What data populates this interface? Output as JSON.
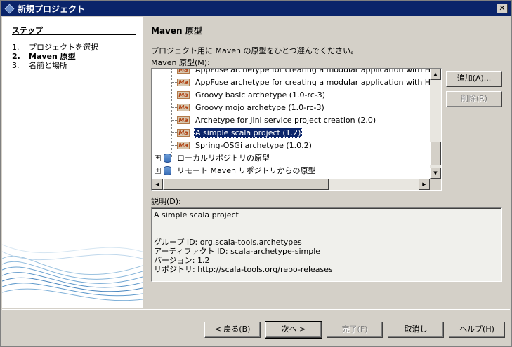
{
  "window": {
    "title": "新規プロジェクト",
    "close_glyph": "✕"
  },
  "steps": {
    "heading": "ステップ",
    "items": [
      {
        "num": "1.",
        "label": "プロジェクトを選択"
      },
      {
        "num": "2.",
        "label": "Maven 原型"
      },
      {
        "num": "3.",
        "label": "名前と場所"
      }
    ]
  },
  "main": {
    "title": "Maven 原型",
    "description": "プロジェクト用に Maven の原型をひとつ選んでください。",
    "list_label": "Maven 原型(M):",
    "archetypes": [
      "AppFuse archetype for creating a modular application with Hiber",
      "AppFuse archetype for creating a modular application with Hiber",
      "Groovy basic archetype (1.0-rc-3)",
      "Groovy mojo archetype (1.0-rc-3)",
      "Archetype for Jini service project creation (2.0)",
      "A simple scala project (1.2)",
      "Spring-OSGi archetype (1.0.2)"
    ],
    "selected_archetype": "A simple scala project (1.2)",
    "repositories": [
      "ローカルリポジトリの原型",
      "リモート Maven リポジトリからの原型"
    ],
    "add_button": "追加(A)...",
    "remove_button": "削除(R)",
    "info_label": "説明(D):",
    "info": {
      "summary": "A simple scala project",
      "group_id": "グループ ID: org.scala-tools.archetypes",
      "artifact_id": "アーティファクト ID: scala-archetype-simple",
      "version": "バージョン: 1.2",
      "repository": "リポジトリ: http://scala-tools.org/repo-releases"
    }
  },
  "footer": {
    "back": "< 戻る(B)",
    "next": "次へ >",
    "finish": "完了(F)",
    "cancel": "取消し",
    "help": "ヘルプ(H)"
  },
  "colors": {
    "title_bar": "#0a246a",
    "dialog_bg": "#d4d0c8",
    "selection": "#0a246a"
  }
}
